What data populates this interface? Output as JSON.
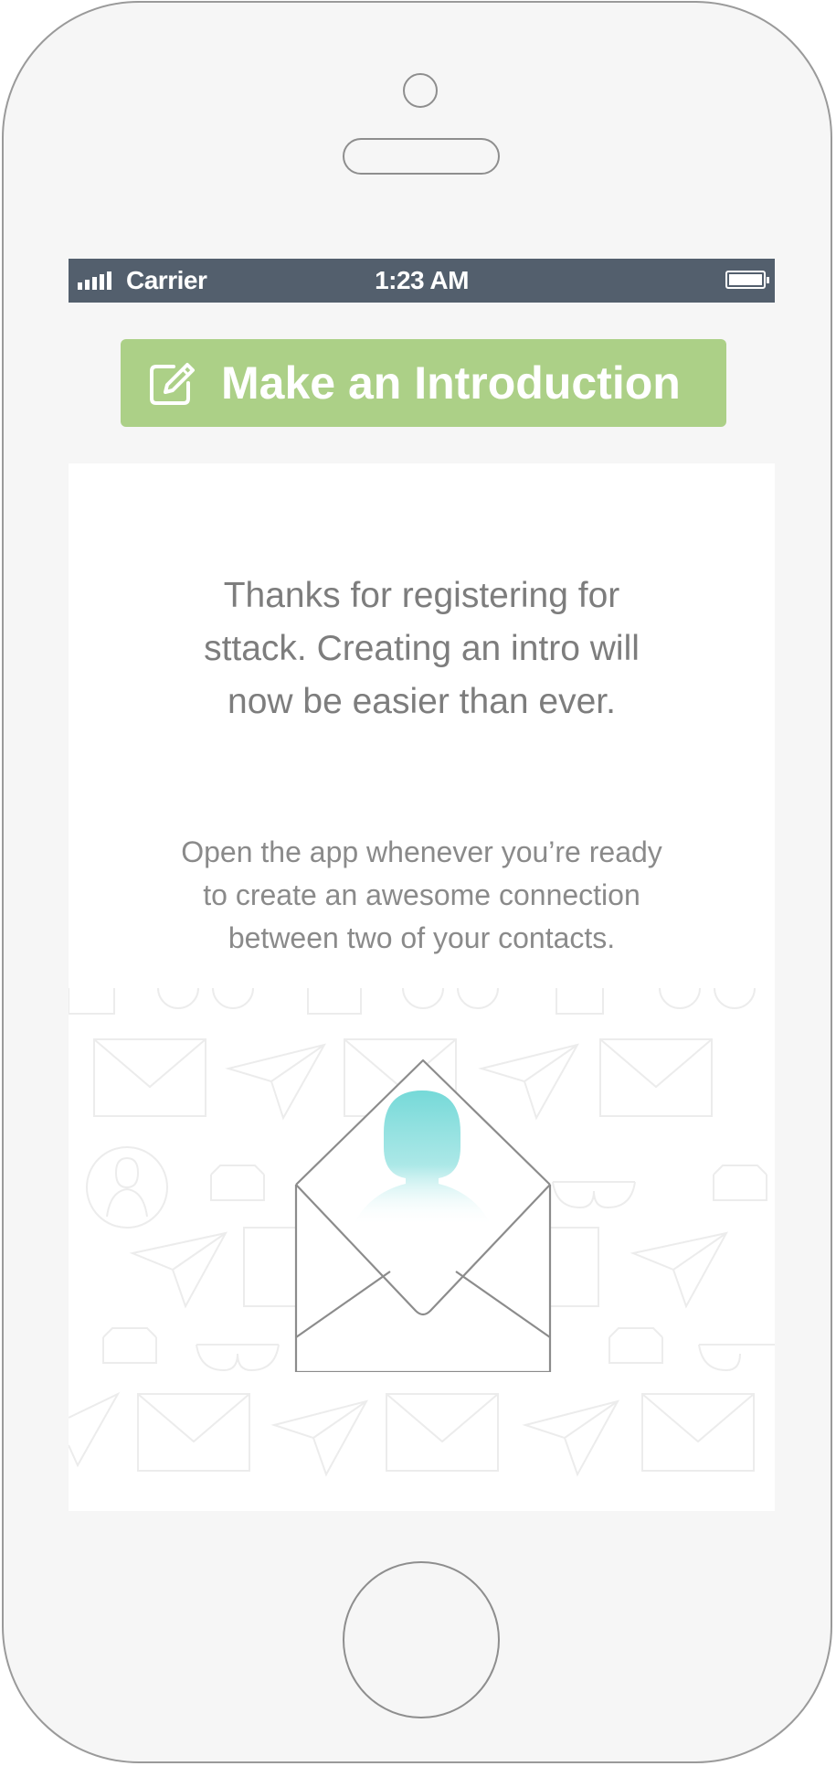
{
  "status_bar": {
    "carrier": "Carrier",
    "time": "1:23 AM",
    "signal_bars": 5,
    "battery_level": 1.0
  },
  "intro_button": {
    "label": "Make an Introduction",
    "icon": "compose-icon"
  },
  "content": {
    "headline": "Thanks for registering for sttack. Creating an intro will now be easier than ever.",
    "subtext": "Open the app whenever you’re ready to create an awesome connection between two of your contacts.",
    "illustration": "open-envelope-with-contact-icon"
  },
  "colors": {
    "status_bar": "#535f6d",
    "button_green": "#acd087",
    "text_gray": "#7d7d7d",
    "accent_teal": "#75d9d8"
  }
}
